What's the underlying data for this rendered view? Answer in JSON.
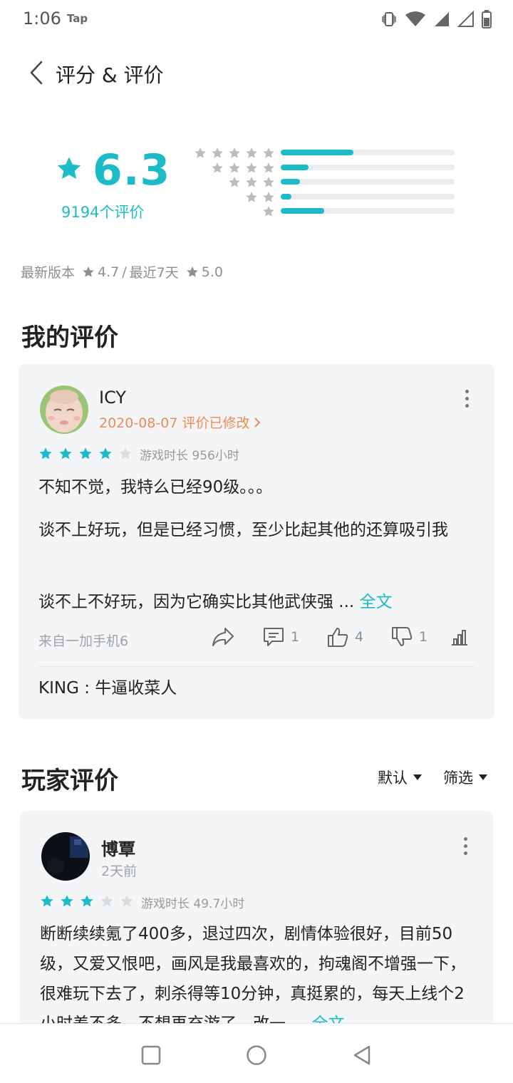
{
  "status": {
    "time": "1:06",
    "app_indicator": "Tap"
  },
  "header": {
    "title": "评分 & 评价"
  },
  "rating": {
    "score": "6.3",
    "count_label": "9194个评价",
    "distribution": [
      {
        "stars": 5,
        "fraction": 0.42
      },
      {
        "stars": 4,
        "fraction": 0.16
      },
      {
        "stars": 3,
        "fraction": 0.11
      },
      {
        "stars": 2,
        "fraction": 0.06
      },
      {
        "stars": 1,
        "fraction": 0.25
      }
    ]
  },
  "versions": {
    "latest_label": "最新版本",
    "latest_score": "4.7",
    "separator": "/",
    "recent_label": "最近7天",
    "recent_score": "5.0"
  },
  "my_review_section": {
    "title": "我的评价",
    "review": {
      "user": "ICY",
      "date_status": "2020-08-07 评价已修改",
      "rating": 4,
      "play_time": "游戏时长 956小时",
      "paragraphs": [
        "不知不觉，我特么已经90级。。。",
        "谈不上好玩，但是已经习惯，至少比起其他的还算吸引我",
        "谈不上不好玩，因为它确实比其他武侠强 ..."
      ],
      "full_text_link": "全文",
      "device": "来自一加手机6",
      "comments": "1",
      "likes": "4",
      "dislikes": "1",
      "reply": {
        "author": "KING",
        "separator": " : ",
        "text": "牛逼收菜人"
      }
    }
  },
  "player_reviews_section": {
    "title": "玩家评价",
    "sort_label": "默认",
    "filter_label": "筛选",
    "review": {
      "user": "博覃",
      "time": "2天前",
      "rating": 3,
      "play_time": "游戏时长 49.7小时",
      "text": "断断续续氪了400多，退过四次，剧情体验很好，目前50级，又爱又恨吧，画风是我最喜欢的，拘魂阁不增强一下，很难玩下去了，刺杀得等10分钟，真挺累的，每天上线个2小时差不多，不想再充游了，改一 ...",
      "full_text_link": "全文"
    }
  },
  "colors": {
    "accent": "#1bbcc7",
    "orange": "#f08b55",
    "star_empty": "#d9dcdf",
    "card_bg": "#f4f5f7"
  },
  "icons": [
    "back-arrow-icon",
    "star-icon",
    "share-icon",
    "comment-icon",
    "thumbs-up-icon",
    "thumbs-down-icon",
    "stats-icon",
    "more-icon",
    "caret-down-icon",
    "nav-recents-icon",
    "nav-home-icon",
    "nav-back-icon"
  ]
}
